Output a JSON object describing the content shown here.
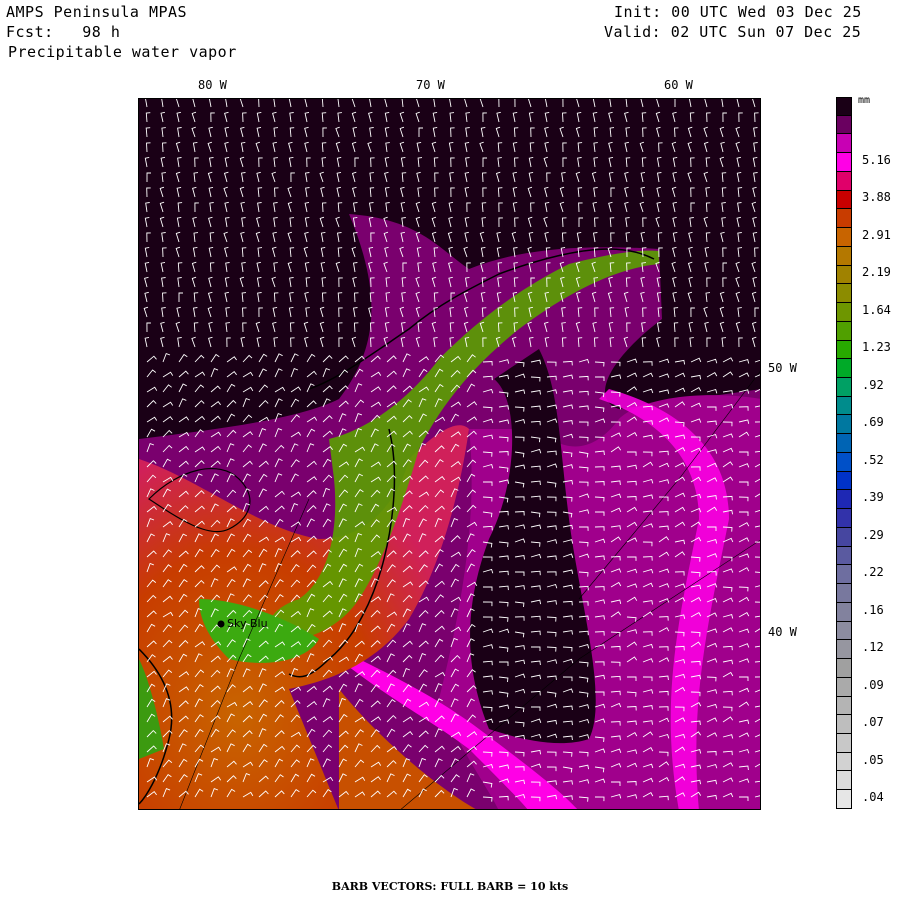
{
  "header": {
    "model": "AMPS Peninsula MPAS",
    "fcst": "Fcst:   98 h",
    "field": "Precipitable water vapor",
    "init": "Init: 00 UTC Wed 03 Dec 25",
    "valid": "Valid: 02 UTC Sun 07 Dec 25"
  },
  "map": {
    "lon_labels": [
      "80 W",
      "70 W",
      "60 W"
    ],
    "lat_labels": [
      "50 W",
      "40 W"
    ],
    "station": {
      "name": "Sky Blu"
    },
    "barb_color": "#ffffff"
  },
  "colorbar": {
    "unit": "mm",
    "labels": [
      "5.16",
      "3.88",
      "2.91",
      "2.19",
      "1.64",
      "1.23",
      ".92",
      ".69",
      ".52",
      ".39",
      ".29",
      ".22",
      ".16",
      ".12",
      ".09",
      ".07",
      ".05",
      ".04"
    ],
    "colors_top_to_bottom": [
      "#1a0016",
      "#6a0060",
      "#c800b4",
      "#ff00e6",
      "#e0006a",
      "#c80000",
      "#c83c00",
      "#c86400",
      "#b47800",
      "#a08200",
      "#8c8c00",
      "#6e9600",
      "#50a000",
      "#28aa00",
      "#00aa28",
      "#00a064",
      "#008c8c",
      "#0078a0",
      "#0064b4",
      "#0050c8",
      "#0032c8",
      "#1e28b4",
      "#3232aa",
      "#4646a0",
      "#5a5aa0",
      "#6e6ea0",
      "#78789e",
      "#82829e",
      "#8c8ca0",
      "#9696a0",
      "#a0a0a0",
      "#aaaaaa",
      "#b4b4b4",
      "#bebebe",
      "#c8c8c8",
      "#d2d2d2",
      "#dcdcdc",
      "#e6e6e6"
    ]
  },
  "footer": "BARB VECTORS:  FULL BARB = 10 kts"
}
